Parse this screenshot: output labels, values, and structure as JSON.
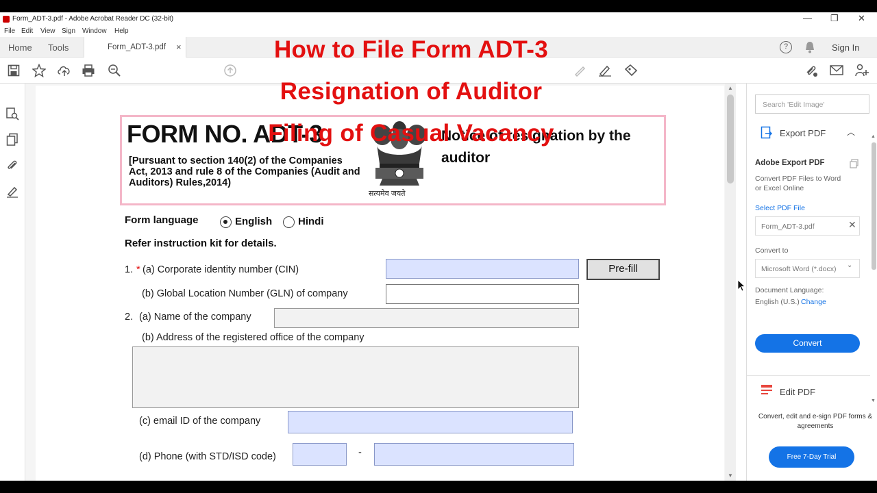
{
  "window": {
    "title": "Form_ADT-3.pdf - Adobe Acrobat Reader DC (32-bit)",
    "controls": [
      "—",
      "❐",
      "✕"
    ]
  },
  "menu": [
    "File",
    "Edit",
    "View",
    "Sign",
    "Window",
    "Help"
  ],
  "tabs": {
    "home": "Home",
    "tools": "Tools",
    "document": "Form_ADT-3.pdf",
    "close": "×",
    "sign_in": "Sign In"
  },
  "overlay": {
    "line1": "How to File Form ADT-3",
    "line2": "Resignation of Auditor",
    "line3": "Filing of Casual Vacancy"
  },
  "form": {
    "form_no": "FORM NO. ADT-3",
    "pursuant": "[Pursuant to section 140(2) of the Companies Act, 2013 and rule 8 of the Companies (Audit and Auditors) Rules,2014)",
    "emblem_caption": "सत्यमेव जयते",
    "notice": "Notice of resignation by the auditor",
    "form_language_label": "Form language",
    "lang_english": "English",
    "lang_hindi": "Hindi",
    "refer": "Refer instruction kit for details.",
    "q1a_num": "1.",
    "q1a_req": "*",
    "q1a": "(a) Corporate identity number (CIN)",
    "prefill": "Pre-fill",
    "q1b": "(b) Global Location Number (GLN) of company",
    "q2a_num": "2.",
    "q2a": "(a) Name of the company",
    "q2b": "(b) Address of the registered office of the company",
    "q2c": "(c) email ID of the company",
    "q2d": "(d) Phone (with STD/ISD code)",
    "phone_sep": "-"
  },
  "right_panel": {
    "search_placeholder": "Search 'Edit Image'",
    "export_pdf": "Export PDF",
    "adobe_export_pdf": "Adobe Export PDF",
    "convert_desc": "Convert PDF Files to Word or Excel Online",
    "select_pdf": "Select PDF File",
    "file_name": "Form_ADT-3.pdf",
    "convert_to": "Convert to",
    "format": "Microsoft Word (*.docx)",
    "doc_language": "Document Language:",
    "language_value": "English (U.S.)",
    "change": "Change",
    "convert_btn": "Convert",
    "edit_pdf": "Edit PDF",
    "promo": "Convert, edit and e-sign PDF forms & agreements",
    "trial_btn": "Free 7-Day Trial"
  },
  "colors": {
    "overlay_red": "#e31010",
    "acrobat_blue": "#1473e6",
    "field_blue": "#dbe3ff",
    "header_border": "#f4b6c8"
  }
}
